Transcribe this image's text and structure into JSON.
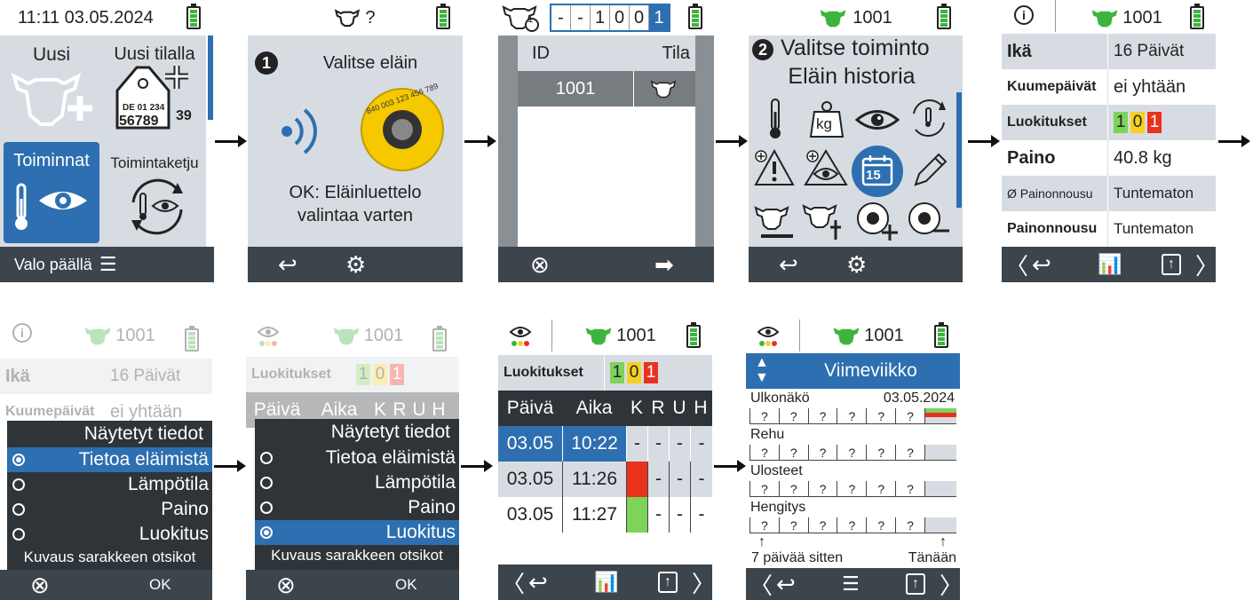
{
  "screen1": {
    "datetime": "11:11 03.05.2024",
    "new_label": "Uusi",
    "new_on_farm_label": "Uusi tilalla",
    "tag_line1": "DE 01 234",
    "tag_line2": "56789",
    "tag_line2b": "39",
    "actions_label": "Toiminnat",
    "action_chain_label": "Toimintaketju",
    "light_label": "Valo päällä"
  },
  "screen2": {
    "header_text": "?",
    "step_number": "1",
    "title": "Valitse eläin",
    "tag_number": "840 003 123 456 789",
    "hint_line1": "OK: Eläinluettelo",
    "hint_line2": "valintaa varten"
  },
  "screen3": {
    "id_digits": [
      "-",
      "-",
      "1",
      "0",
      "0",
      "1"
    ],
    "sub_count": "1",
    "col_id": "ID",
    "col_state": "Tila",
    "row_id": "1001"
  },
  "screen4": {
    "animal_id": "1001",
    "step_number": "2",
    "title_line1": "Valitse toiminto",
    "title_line2": "Eläin historia",
    "kg_label": "kg",
    "calendar_day": "15"
  },
  "screen5": {
    "animal_id": "1001",
    "rows": [
      {
        "label": "Ikä",
        "value": "16 Päivät"
      },
      {
        "label": "Kuumepäivät",
        "value": "ei yhtään"
      },
      {
        "label": "Luokitukset",
        "value": ""
      },
      {
        "label": "Paino",
        "value": "40.8 kg"
      },
      {
        "label": "Ø Painonnousu",
        "value": "Tuntematon"
      },
      {
        "label": "Painonnousu",
        "value": "Tuntematon"
      }
    ],
    "classification": [
      "1",
      "0",
      "1"
    ]
  },
  "screen6": {
    "animal_id": "1001",
    "bg_rows": [
      {
        "label": "Ikä",
        "value": "16 Päivät"
      },
      {
        "label": "Kuumepäivät",
        "value": "ei yhtään"
      }
    ],
    "menu_title": "Näytetyt tiedot",
    "options": [
      "Tietoa eläimistä",
      "Lämpötila",
      "Paino",
      "Luokitus"
    ],
    "footer_label": "Kuvaus sarakkeen otsikot",
    "ok_label": "OK"
  },
  "screen7": {
    "animal_id": "1001",
    "class_label": "Luokitukset",
    "classification": [
      "1",
      "0",
      "1"
    ],
    "cols": [
      "Päivä",
      "Aika",
      "K",
      "R",
      "U",
      "H"
    ],
    "menu_title": "Näytetyt tiedot",
    "options": [
      "Tietoa eläimistä",
      "Lämpötila",
      "Paino",
      "Luokitus"
    ],
    "footer_label": "Kuvaus sarakkeen otsikot",
    "ok_label": "OK"
  },
  "screen8": {
    "animal_id": "1001",
    "class_label": "Luokitukset",
    "classification": [
      "1",
      "0",
      "1"
    ],
    "cols": [
      "Päivä",
      "Aika",
      "K",
      "R",
      "U",
      "H"
    ],
    "rows": [
      {
        "date": "03.05",
        "time": "10:22",
        "k": "-",
        "r": "-",
        "u": "-",
        "h": "-"
      },
      {
        "date": "03.05",
        "time": "11:26",
        "k": "",
        "r": "-",
        "u": "-",
        "h": "-"
      },
      {
        "date": "03.05",
        "time": "11:27",
        "k": "",
        "r": "-",
        "u": "-",
        "h": "-"
      }
    ]
  },
  "screen9": {
    "animal_id": "1001",
    "period_label": "Viimeviikko",
    "date": "03.05.2024",
    "rows": [
      {
        "label": "Ulkonäkö",
        "cells": [
          "?",
          "?",
          "?",
          "?",
          "?",
          "?"
        ]
      },
      {
        "label": "Rehu",
        "cells": [
          "?",
          "?",
          "?",
          "?",
          "?",
          "?"
        ]
      },
      {
        "label": "Ulosteet",
        "cells": [
          "?",
          "?",
          "?",
          "?",
          "?",
          "?"
        ]
      },
      {
        "label": "Hengitys",
        "cells": [
          "?",
          "?",
          "?",
          "?",
          "?",
          "?"
        ]
      }
    ],
    "left_caption": "7 päivää sitten",
    "right_caption": "Tänään"
  },
  "colors": {
    "accent_blue": "#2d6fb0",
    "cow_green": "#3db43d",
    "class_green": "#7ed35a",
    "class_yellow": "#f5d020",
    "class_red": "#e8321e",
    "bar_dark": "#3c444c"
  }
}
